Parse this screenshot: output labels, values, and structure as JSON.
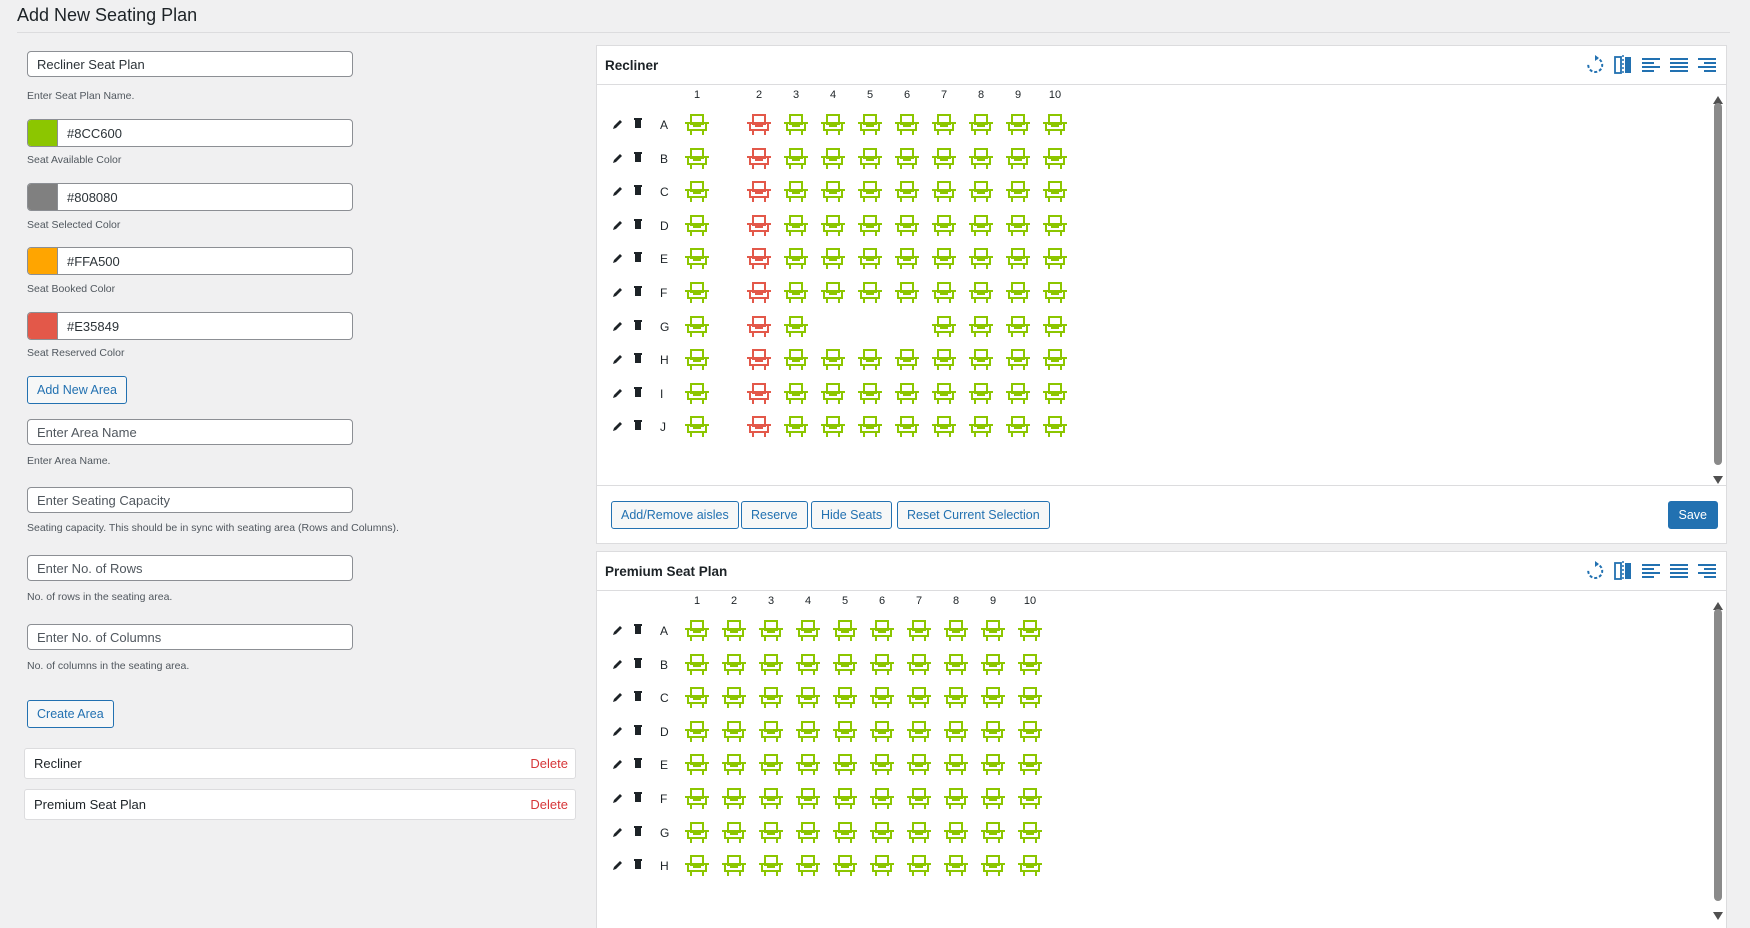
{
  "page": {
    "title": "Add New Seating Plan"
  },
  "form": {
    "plan_name_value": "Recliner Seat Plan",
    "plan_name_help": "Enter Seat Plan Name.",
    "colors": [
      {
        "hex": "#8CC600",
        "help": "Seat Available Color"
      },
      {
        "hex": "#808080",
        "help": "Seat Selected Color"
      },
      {
        "hex": "#FFA500",
        "help": "Seat Booked Color"
      },
      {
        "hex": "#E35849",
        "help": "Seat Reserved Color"
      }
    ],
    "add_area_label": "Add New Area",
    "area_name_placeholder": "Enter Area Name",
    "area_name_help": "Enter Area Name.",
    "capacity_placeholder": "Enter Seating Capacity",
    "capacity_help": "Seating capacity. This should be in sync with seating area (Rows and Columns).",
    "rows_placeholder": "Enter No. of Rows",
    "rows_help": "No. of rows in the seating area.",
    "cols_placeholder": "Enter No. of Columns",
    "cols_help": "No. of columns in the seating area.",
    "create_area_label": "Create Area"
  },
  "areas": [
    {
      "name": "Recliner",
      "delete_label": "Delete"
    },
    {
      "name": "Premium Seat Plan",
      "delete_label": "Delete"
    }
  ],
  "panels": [
    {
      "title": "Recliner",
      "columns": [
        "1",
        "2",
        "3",
        "4",
        "5",
        "6",
        "7",
        "8",
        "9",
        "10"
      ],
      "rows": [
        "A",
        "B",
        "C",
        "D",
        "E",
        "F",
        "G",
        "H",
        "I",
        "J"
      ],
      "column_gap_after": [
        1
      ],
      "reserved_column": 2,
      "hidden_seats": {
        "G": [
          4,
          5,
          6
        ]
      },
      "buttons": [
        "Add/Remove aisles",
        "Reserve",
        "Hide Seats",
        "Reset Current Selection"
      ],
      "save_label": "Save"
    },
    {
      "title": "Premium Seat Plan",
      "columns": [
        "1",
        "2",
        "3",
        "4",
        "5",
        "6",
        "7",
        "8",
        "9",
        "10"
      ],
      "rows": [
        "A",
        "B",
        "C",
        "D",
        "E",
        "F",
        "G",
        "H"
      ],
      "column_gap_after": [],
      "reserved_column": null,
      "hidden_seats": {}
    }
  ],
  "colors": {
    "available": "#8CC600",
    "reserved": "#E35849",
    "accent": "#2271b1",
    "danger": "#d63638"
  },
  "icons": {
    "panel_tools": [
      "rotate-icon",
      "flip-icon",
      "align-left-icon",
      "align-center-icon",
      "align-right-icon"
    ],
    "row_tools": [
      "pencil-icon",
      "trash-icon"
    ],
    "seat": "armchair-icon"
  }
}
